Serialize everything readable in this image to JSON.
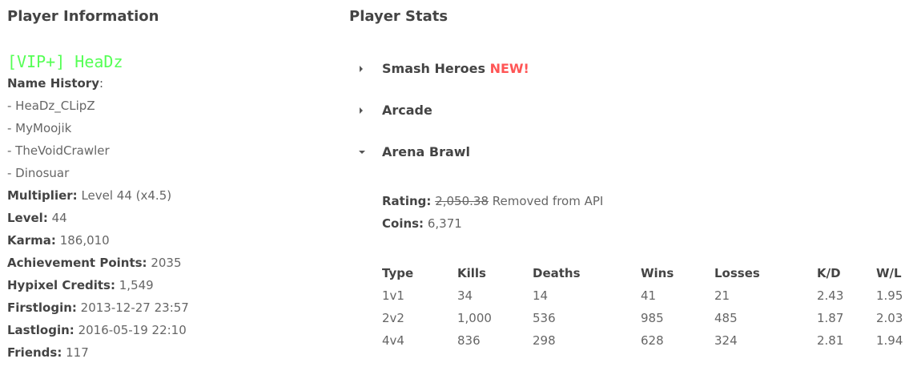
{
  "left": {
    "heading": "Player Information",
    "player_name": "[VIP+] HeaDz",
    "player_name_color": "#55ff55",
    "name_history_label": "Name History",
    "name_history_colon": ":",
    "name_history": [
      "- HeaDz_CLipZ",
      "- MyMoojik",
      "- TheVoidCrawler",
      "- Dinosuar"
    ],
    "fields": [
      {
        "label": "Multiplier:",
        "value": "Level 44 (x4.5)"
      },
      {
        "label": "Level:",
        "value": "44"
      },
      {
        "label": "Karma:",
        "value": "186,010"
      },
      {
        "label": "Achievement Points:",
        "value": "2035"
      },
      {
        "label": "Hypixel Credits:",
        "value": "1,549"
      },
      {
        "label": "Firstlogin:",
        "value": "2013-12-27 23:57"
      },
      {
        "label": "Lastlogin:",
        "value": "2016-05-19 22:10"
      },
      {
        "label": "Friends:",
        "value": "117"
      }
    ]
  },
  "right": {
    "heading": "Player Stats",
    "sections": [
      {
        "title": "Smash Heroes",
        "badge": "NEW!",
        "expanded": false
      },
      {
        "title": "Arcade",
        "expanded": false
      },
      {
        "title": "Arena Brawl",
        "expanded": true
      }
    ],
    "arena": {
      "rating_label": "Rating:",
      "rating_value": "2,050.38",
      "rating_note": "Removed from API",
      "coins_label": "Coins:",
      "coins_value": "6,371",
      "table": {
        "headers": [
          "Type",
          "Kills",
          "Deaths",
          "Wins",
          "Losses",
          "K/D",
          "W/L"
        ],
        "rows": [
          [
            "1v1",
            "34",
            "14",
            "41",
            "21",
            "2.43",
            "1.95"
          ],
          [
            "2v2",
            "1,000",
            "536",
            "985",
            "485",
            "1.87",
            "2.03"
          ],
          [
            "4v4",
            "836",
            "298",
            "628",
            "324",
            "2.81",
            "1.94"
          ]
        ]
      }
    },
    "badge_color": "#ff5555"
  }
}
